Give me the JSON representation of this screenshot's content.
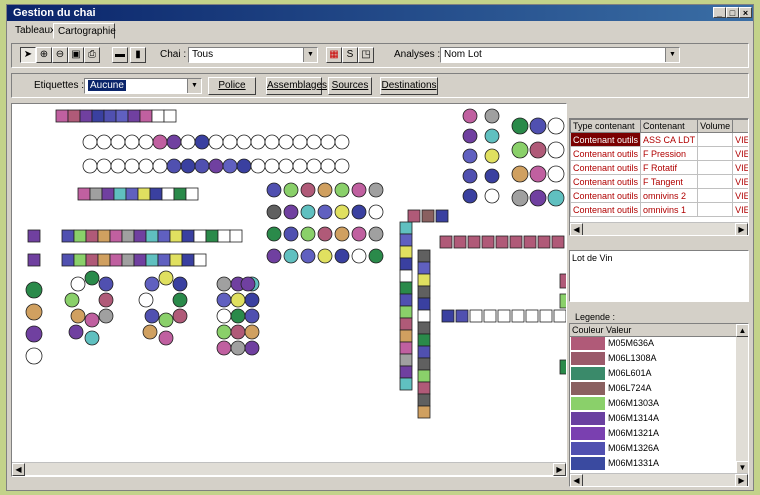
{
  "window": {
    "title": "Gestion du chai",
    "min": "_",
    "max": "□",
    "close": "×"
  },
  "tabs": [
    {
      "label": "Tableaux"
    },
    {
      "label": "Cartographie"
    }
  ],
  "toolbar1": {
    "chai_label": "Chai :",
    "chai_value": "Tous",
    "analyses_label": "Analyses :",
    "analyses_value": "Nom Lot"
  },
  "toolbar2": {
    "etiquettes_label": "Etiquettes :",
    "etiquettes_value": "Aucune",
    "police": "Police",
    "assemblages": "Assemblages",
    "sources": "Sources",
    "destinations": "Destinations"
  },
  "table": {
    "headers": [
      "Type contenant",
      "Contenant",
      "Volume",
      ""
    ],
    "rows": [
      [
        "Contenant outils",
        "ASS CA LDT",
        "",
        "VIEIL"
      ],
      [
        "Contenant outils",
        "F Pression",
        "",
        "VIEIL"
      ],
      [
        "Contenant outils",
        "F Rotatif",
        "",
        "VIEIL"
      ],
      [
        "Contenant outils",
        "F Tangent",
        "",
        "VIEIL"
      ],
      [
        "Contenant outils",
        "omnivins 2",
        "",
        "VIEIL"
      ],
      [
        "Contenant outils",
        "omnivins 1",
        "",
        "VIEIL"
      ]
    ]
  },
  "lot": {
    "label": "Lot de Vin"
  },
  "legend": {
    "title": "Legende :",
    "col_couleur": "Couleur",
    "col_valeur": "Valeur",
    "items": [
      {
        "color": "#b05a78",
        "value": "M05M636A"
      },
      {
        "color": "#9a5a6a",
        "value": "M06L1308A"
      },
      {
        "color": "#3a8a6a",
        "value": "M06L601A"
      },
      {
        "color": "#8a6060",
        "value": "M06L724A"
      },
      {
        "color": "#8ad06a",
        "value": "M06M1303A"
      },
      {
        "color": "#6a40a0",
        "value": "M06M1314A"
      },
      {
        "color": "#7a40b0",
        "value": "M06M1321A"
      },
      {
        "color": "#5050b0",
        "value": "M06M1326A"
      },
      {
        "color": "#3a4aa0",
        "value": "M06M1331A"
      }
    ]
  },
  "icons": [
    "pointer-icon",
    "zoom-in-icon",
    "zoom-out-icon",
    "picture-icon",
    "print-icon",
    "horizontal-bar-icon",
    "vertical-bar-icon",
    "color-palette-icon",
    "s-icon",
    "window-icon"
  ]
}
